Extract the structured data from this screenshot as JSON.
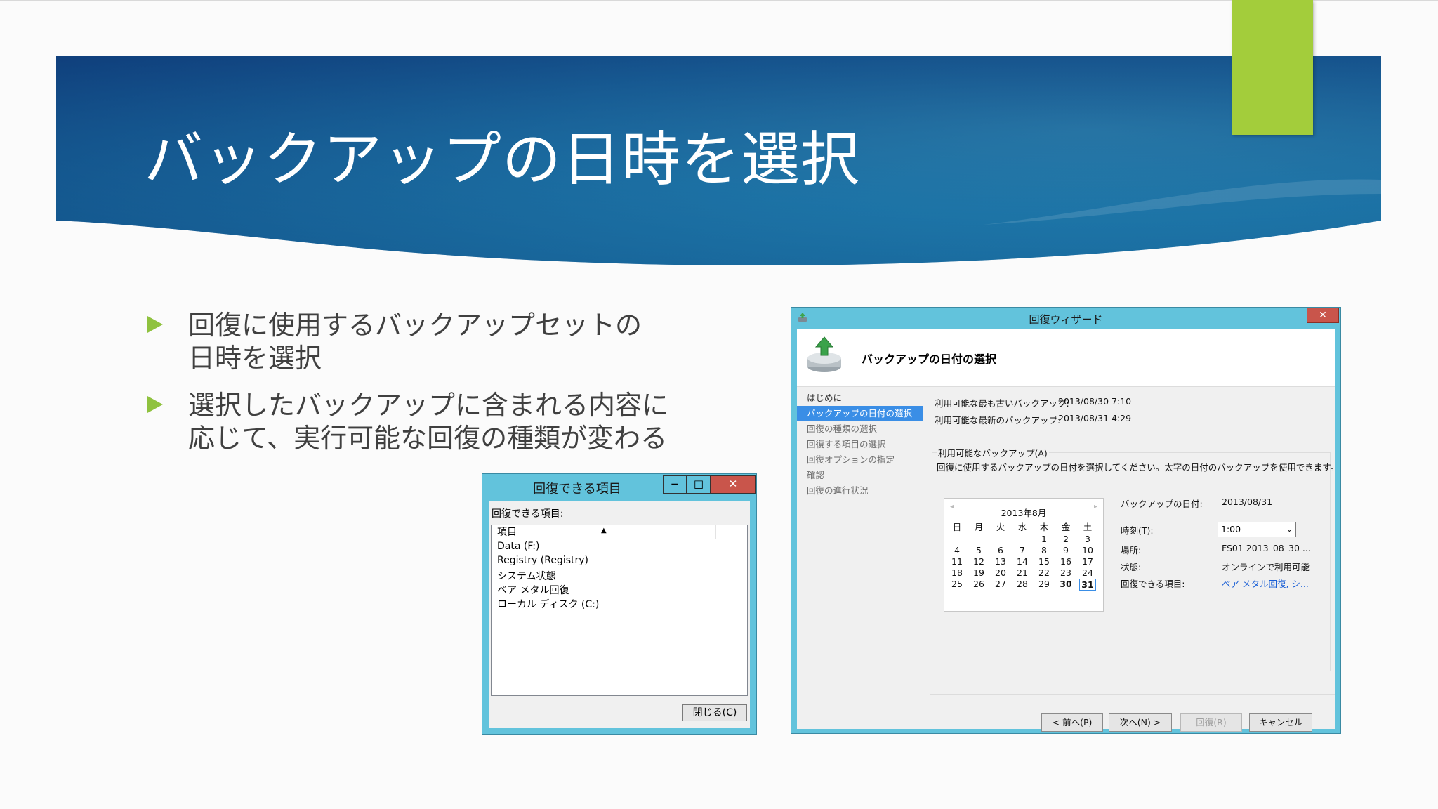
{
  "slide": {
    "title": "バックアップの日時を選択",
    "bullets": [
      [
        "回復に使用するバックアップセットの",
        "日時を選択"
      ],
      [
        "選択したバックアップに含まれる内容に",
        "応じて、実行可能な回復の種類が変わる"
      ]
    ],
    "colors": {
      "banner_dark": "#0e3a78",
      "banner_light": "#1f86b5",
      "accent": "#a3cd3b",
      "bullet_arrow": "#8fc23f"
    }
  },
  "items_dialog": {
    "title": "回復できる項目",
    "min_glyph": "−",
    "max_glyph": "□",
    "close_glyph": "✕",
    "label": "回復できる項目:",
    "column_header": "項目",
    "sort_glyph": "▲",
    "rows": [
      "Data (F:)",
      "Registry (Registry)",
      "システム状態",
      "ベア メタル回復",
      "ローカル ディスク (C:)"
    ],
    "close_button": "閉じる(C)"
  },
  "wizard": {
    "title": "回復ウィザード",
    "close_glyph": "✕",
    "header_title": "バックアップの日付の選択",
    "nav": [
      "はじめに",
      "バックアップの日付の選択",
      "回復の種類の選択",
      "回復する項目の選択",
      "回復オプションの指定",
      "確認",
      "回復の進行状況"
    ],
    "selected_nav_index": 1,
    "oldest_label": "利用可能な最も古いバックアップ:",
    "oldest_value": "2013/08/30 7:10",
    "newest_label": "利用可能な最新のバックアップ:",
    "newest_value": "2013/08/31 4:29",
    "group_label": "利用可能なバックアップ(A)",
    "group_desc": "回復に使用するバックアップの日付を選択してください。太字の日付のバックアップを使用できます。",
    "calendar": {
      "month": "2013年8月",
      "prev": "◂",
      "next": "▸",
      "dow": [
        "日",
        "月",
        "火",
        "水",
        "木",
        "金",
        "土"
      ],
      "weeks": [
        [
          "",
          "",
          "",
          "",
          "1",
          "2",
          "3"
        ],
        [
          "4",
          "5",
          "6",
          "7",
          "8",
          "9",
          "10"
        ],
        [
          "11",
          "12",
          "13",
          "14",
          "15",
          "16",
          "17"
        ],
        [
          "18",
          "19",
          "20",
          "21",
          "22",
          "23",
          "24"
        ],
        [
          "25",
          "26",
          "27",
          "28",
          "29",
          "30",
          "31"
        ]
      ],
      "bold_days": [
        "30",
        "31"
      ],
      "selected_day": "31"
    },
    "props": {
      "date_label": "バックアップの日付:",
      "date_value": "2013/08/31",
      "time_label": "時刻(T):",
      "time_value": "1:00",
      "location_label": "場所:",
      "location_value": "FS01 2013_08_30 ...",
      "status_label": "状態:",
      "status_value": "オンラインで利用可能",
      "items_label": "回復できる項目:",
      "items_value": "ベア メタル回復, シ..."
    },
    "buttons": {
      "back": "< 前へ(P)",
      "next": "次へ(N) >",
      "recover": "回復(R)",
      "cancel": "キャンセル"
    }
  }
}
